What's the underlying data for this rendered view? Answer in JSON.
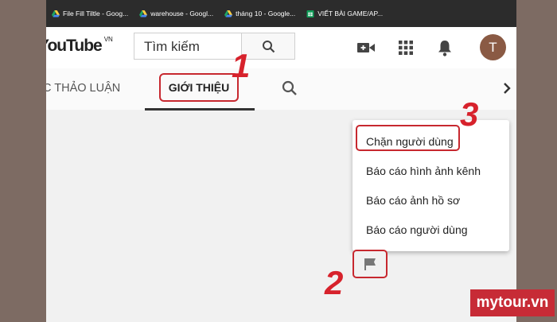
{
  "bookmarks": [
    {
      "label": "File Fill Tiltle - Goog...",
      "icon": "drive-icon"
    },
    {
      "label": "warehouse - Googl...",
      "icon": "drive-icon"
    },
    {
      "label": "tháng 10 - Google...",
      "icon": "drive-icon"
    },
    {
      "label": "VIẾT BÀI GAME/AP...",
      "icon": "sheets-icon"
    }
  ],
  "header": {
    "logo_text": "YouTube",
    "logo_region": "VN",
    "search_placeholder": "Tìm kiếm",
    "avatar_letter": "T"
  },
  "tabs": {
    "discussion": "C THẢO LUẬN",
    "about": "GIỚI THIỆU"
  },
  "menu": {
    "items": [
      "Chặn người dùng",
      "Báo cáo hình ảnh kênh",
      "Báo cáo ảnh hồ sơ",
      "Báo cáo người dùng"
    ]
  },
  "step_numbers": [
    "1",
    "2",
    "3"
  ],
  "watermark": "mytour.vn",
  "colors": {
    "highlight_red": "#c7282f",
    "bookmark_bar": "#2c2c2c",
    "avatar_brown": "#8a5a44"
  }
}
